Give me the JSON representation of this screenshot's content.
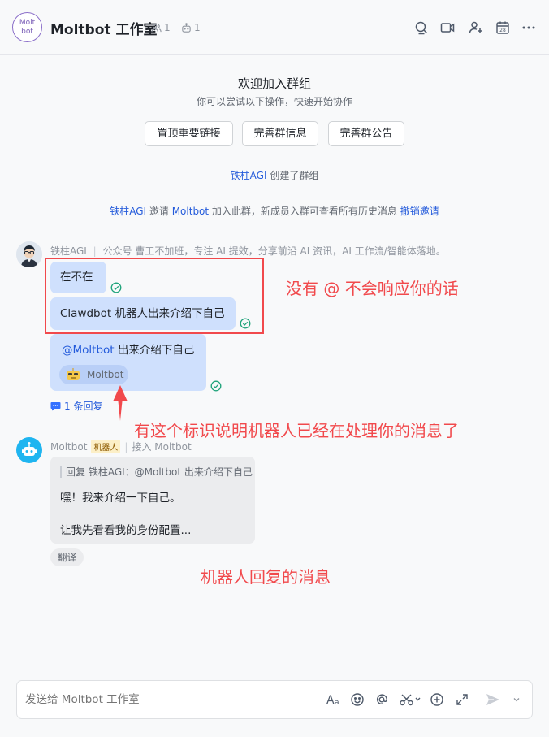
{
  "header": {
    "logo_text_1": "Molt",
    "logo_text_2": "bot",
    "title": "Moltbot 工作室",
    "member_count": "1",
    "bot_count": "1"
  },
  "welcome": {
    "title": "欢迎加入群组",
    "subtitle": "你可以尝试以下操作，快速开始协作",
    "actions": [
      "置顶重要链接",
      "完善群信息",
      "完善群公告"
    ]
  },
  "system": {
    "created_user": "铁柱AGI",
    "created_text": " 创建了群组",
    "invite_user": "铁柱AGI",
    "invite_mid": " 邀请 ",
    "invite_target": "Moltbot",
    "invite_tail": " 加入此群，新成员入群可查看所有历史消息 ",
    "revoke_link": "撤销邀请"
  },
  "msg1": {
    "sender": "铁柱AGI",
    "sender_bio": "公众号 曹工不加班，专注 AI 提效，分享前沿 AI 资讯，AI 工作流/智能体落地。",
    "bubbles": [
      "在不在",
      "Clawdbot 机器人出来介绍下自己"
    ],
    "mention_name": "@Moltbot",
    "mention_text": " 出来介绍下自己",
    "bot_tag": "Moltbot",
    "reply_count": "1 条回复"
  },
  "msg2": {
    "sender": "Moltbot",
    "badge": "机器人",
    "via": "接入 Moltbot",
    "quote": "回复 铁柱AGI：@Moltbot 出来介绍下自己",
    "line1": "嘿！我来介绍一下自己。",
    "line2": "让我先看看我的身份配置...",
    "translate": "翻译"
  },
  "annotations": {
    "no_mention": "没有 @ 不会响应你的话",
    "processing": "有这个标识说明机器人已经在处理你的消息了",
    "bot_reply": "机器人回复的消息"
  },
  "composer": {
    "placeholder": "发送给 Moltbot 工作室"
  }
}
